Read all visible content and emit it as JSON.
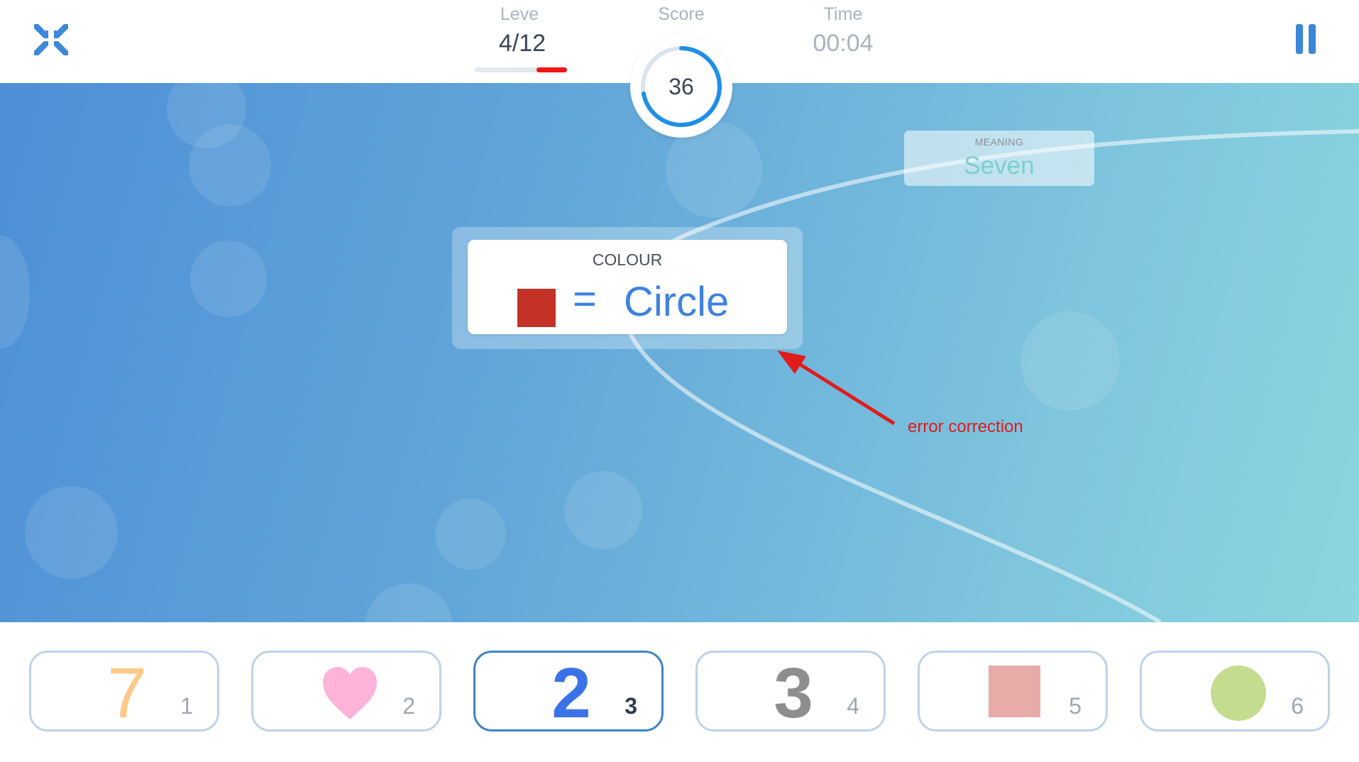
{
  "header": {
    "exit_icon": "compress-arrows-icon",
    "pause_icon": "pause-icon",
    "level_label": "Leve",
    "level_value": "4/12",
    "level_progress": 0.33,
    "score_label": "Score",
    "score_value": "36",
    "score_progress": 0.72,
    "time_label": "Time",
    "time_value": "00:04"
  },
  "meaning_card": {
    "label": "MEANING",
    "value": "Seven"
  },
  "rule_card": {
    "label": "COLOUR",
    "swatch_color": "#c43127",
    "equals": "=",
    "target": "Circle"
  },
  "annotation": {
    "text": "error correction",
    "color": "#e21b1b"
  },
  "answers": [
    {
      "glyph": "7",
      "glyph_color": "#ffc98a",
      "key": "1",
      "type": "digit"
    },
    {
      "glyph": "",
      "glyph_color": "#ffb3d9",
      "key": "2",
      "type": "heart-icon"
    },
    {
      "glyph": "2",
      "glyph_color": "#3a73e8",
      "key": "3",
      "type": "digit",
      "selected": true
    },
    {
      "glyph": "3",
      "glyph_color": "#8e8e8e",
      "key": "4",
      "type": "digit"
    },
    {
      "glyph": "",
      "glyph_color": "#e8aca8",
      "key": "5",
      "type": "square-icon"
    },
    {
      "glyph": "",
      "glyph_color": "#c3dc8f",
      "key": "6",
      "type": "circle-icon"
    }
  ],
  "colors": {
    "accent": "#3b87d6",
    "stage_start": "#4d8fd6",
    "stage_end": "#8bd6df",
    "level_progress": "#ee1515"
  }
}
